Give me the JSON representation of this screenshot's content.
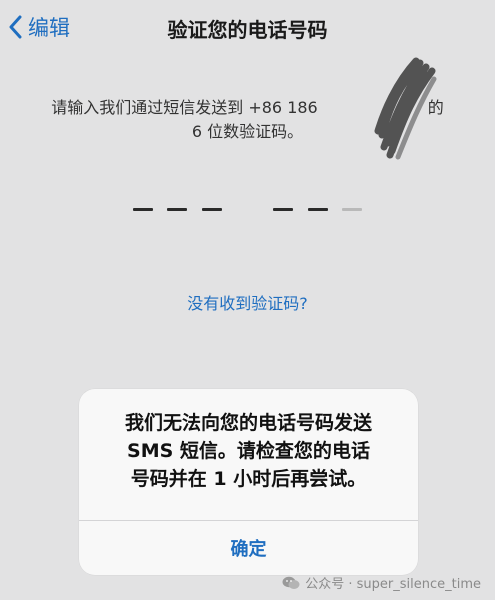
{
  "nav": {
    "back_label": "编辑",
    "title": "验证您的电话号码"
  },
  "instruction": {
    "line1": "请输入我们通过短信发送到 +86 186",
    "line1_suffix": "的",
    "line2": "6 位数验证码。"
  },
  "code": {
    "digits_total": 6
  },
  "no_code_link": "没有收到验证码?",
  "alert": {
    "message_lines": [
      "我们无法向您的电话号码发送",
      "SMS 短信。请检查您的电话",
      "号码并在 1 小时后再尝试。"
    ],
    "button": "确定"
  },
  "watermark": {
    "text": "公众号 · super_silence_time"
  },
  "colors": {
    "accent": "#1f6ec0",
    "background": "#e2e2e3",
    "alert_bg": "#f8f8f8"
  }
}
